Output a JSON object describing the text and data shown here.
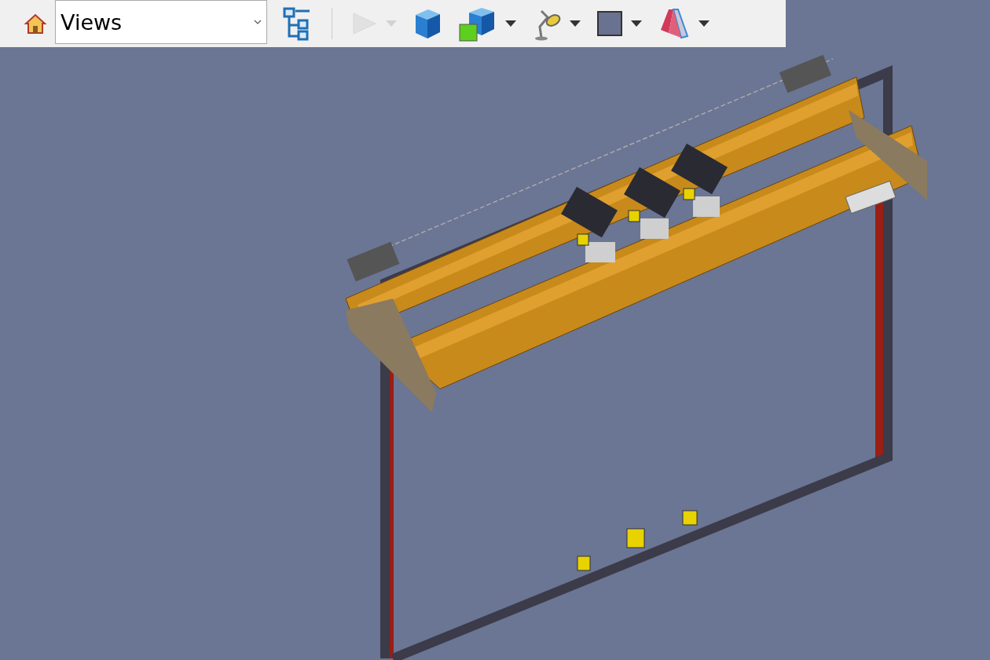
{
  "toolbar": {
    "views_dropdown": {
      "value": "Views"
    },
    "buttons": [
      {
        "kind": "home"
      },
      {
        "kind": "tree"
      },
      {
        "kind": "play",
        "disabled": true,
        "dropdown": true
      },
      {
        "kind": "cube"
      },
      {
        "kind": "cube-square",
        "dropdown": true
      },
      {
        "kind": "lamp",
        "dropdown": true
      },
      {
        "kind": "square",
        "dropdown": true
      },
      {
        "kind": "section",
        "dropdown": true
      }
    ]
  }
}
